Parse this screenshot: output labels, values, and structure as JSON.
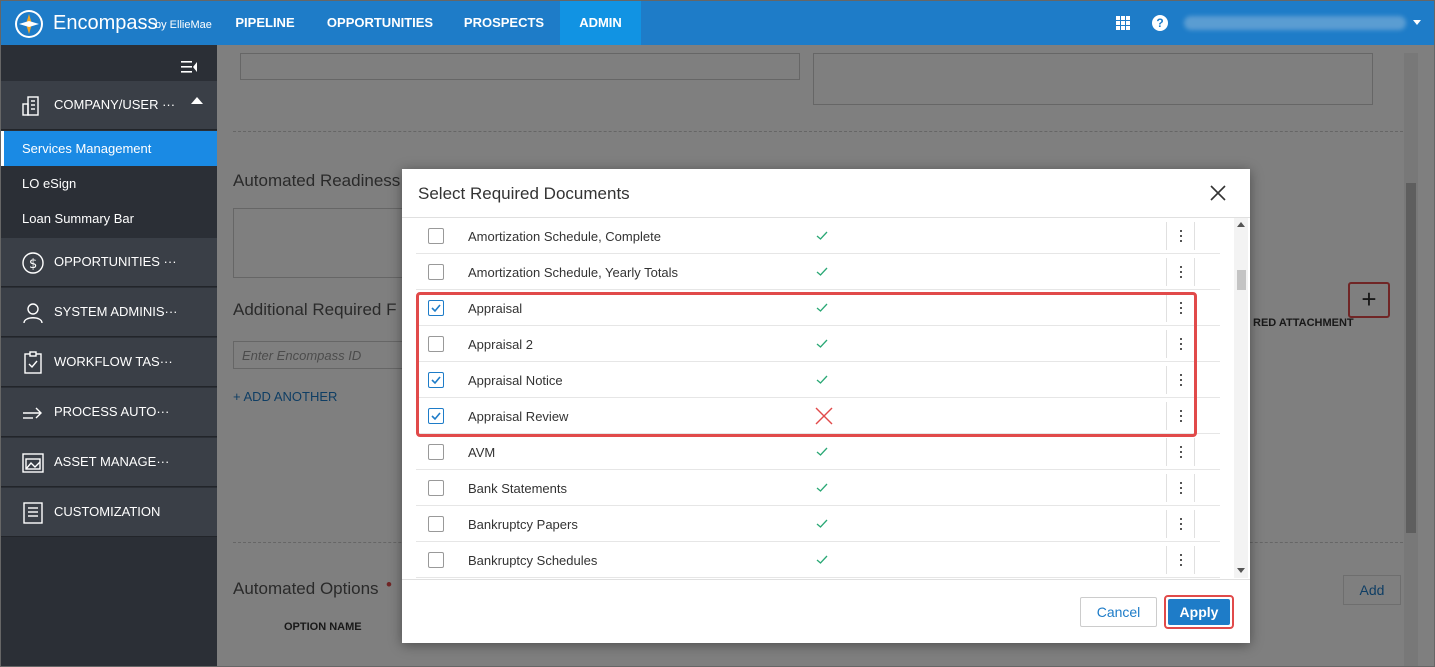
{
  "brand": {
    "name": "Encompass",
    "by": "by EllieMae"
  },
  "nav": [
    {
      "label": "PIPELINE"
    },
    {
      "label": "OPPORTUNITIES"
    },
    {
      "label": "PROSPECTS"
    },
    {
      "label": "ADMIN"
    }
  ],
  "sidebar": {
    "sections": [
      {
        "label": "COMPANY/USER ···",
        "icon": "building-icon"
      },
      {
        "label": "OPPORTUNITIES ···",
        "icon": "dollar-icon"
      },
      {
        "label": "SYSTEM ADMINIS···",
        "icon": "user-icon"
      },
      {
        "label": "WORKFLOW TAS···",
        "icon": "clipboard-check-icon"
      },
      {
        "label": "PROCESS AUTO···",
        "icon": "arrow-right-icon"
      },
      {
        "label": "ASSET MANAGE···",
        "icon": "image-icon"
      },
      {
        "label": "CUSTOMIZATION",
        "icon": "list-icon"
      }
    ],
    "sub_items": [
      {
        "label": "Services Management"
      },
      {
        "label": "LO eSign"
      },
      {
        "label": "Loan Summary Bar"
      }
    ]
  },
  "background": {
    "automated_readiness": "Automated Readiness",
    "additional_required": "Additional Required F",
    "enter_id_placeholder": "Enter Encompass ID",
    "add_another": "+ ADD ANOTHER",
    "red_attachment": "RED ATTACHMENT",
    "automated_options": "Automated Options",
    "required_marker": "•",
    "option_name": "OPTION NAME",
    "add_label": "Add",
    "plus_label": "+"
  },
  "modal": {
    "title": "Select Required Documents",
    "cancel_label": "Cancel",
    "apply_label": "Apply",
    "rows": [
      {
        "name": "Amortization Schedule, Complete",
        "checked": false,
        "status": "check"
      },
      {
        "name": "Amortization Schedule, Yearly Totals",
        "checked": false,
        "status": "check"
      },
      {
        "name": "Appraisal",
        "checked": true,
        "status": "check"
      },
      {
        "name": "Appraisal 2",
        "checked": false,
        "status": "check"
      },
      {
        "name": "Appraisal Notice",
        "checked": true,
        "status": "check"
      },
      {
        "name": "Appraisal Review",
        "checked": true,
        "status": "cross"
      },
      {
        "name": "AVM",
        "checked": false,
        "status": "check"
      },
      {
        "name": "Bank Statements",
        "checked": false,
        "status": "check"
      },
      {
        "name": "Bankruptcy Papers",
        "checked": false,
        "status": "check"
      },
      {
        "name": "Bankruptcy Schedules",
        "checked": false,
        "status": "check"
      }
    ]
  },
  "colors": {
    "accent": "#1e7cc8",
    "highlight": "#e14a4a",
    "check": "#2aa875",
    "sidebar": "#2b2f36"
  }
}
